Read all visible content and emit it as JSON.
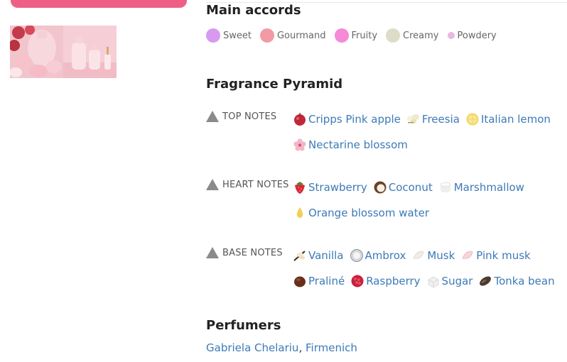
{
  "main_accords": {
    "title": "Main accords",
    "items": [
      {
        "label": "Sweet",
        "color": "#d89af0",
        "size": 20
      },
      {
        "label": "Gourmand",
        "color": "#f29aa6",
        "size": 20
      },
      {
        "label": "Fruity",
        "color": "#f48ad8",
        "size": 20
      },
      {
        "label": "Creamy",
        "color": "#dcdcc8",
        "size": 20
      },
      {
        "label": "Powdery",
        "color": "#e8b8e0",
        "size": 10
      }
    ]
  },
  "pyramid": {
    "title": "Fragrance Pyramid",
    "tiers": [
      {
        "label": "TOP NOTES",
        "rows": [
          [
            {
              "name": "Cripps Pink apple",
              "icon": "apple-icon"
            },
            {
              "name": "Freesia",
              "icon": "freesia-icon"
            },
            {
              "name": "Italian lemon",
              "icon": "lemon-icon"
            }
          ],
          [
            {
              "name": "Nectarine blossom",
              "icon": "blossom-icon"
            }
          ]
        ]
      },
      {
        "label": "HEART NOTES",
        "rows": [
          [
            {
              "name": "Strawberry",
              "icon": "strawberry-icon"
            },
            {
              "name": "Coconut",
              "icon": "coconut-icon"
            },
            {
              "name": "Marshmallow",
              "icon": "marshmallow-icon"
            }
          ],
          [
            {
              "name": "Orange blossom water",
              "icon": "water-drop-icon"
            }
          ]
        ]
      },
      {
        "label": "BASE NOTES",
        "rows": [
          [
            {
              "name": "Vanilla",
              "icon": "vanilla-icon"
            },
            {
              "name": "Ambrox",
              "icon": "ambrox-icon"
            },
            {
              "name": "Musk",
              "icon": "musk-icon"
            },
            {
              "name": "Pink musk",
              "icon": "pink-musk-icon"
            }
          ],
          [
            {
              "name": "Praliné",
              "icon": "praline-icon"
            },
            {
              "name": "Raspberry",
              "icon": "raspberry-icon"
            },
            {
              "name": "Sugar",
              "icon": "sugar-icon"
            },
            {
              "name": "Tonka bean",
              "icon": "tonka-bean-icon"
            }
          ]
        ]
      }
    ]
  },
  "perfumers": {
    "title": "Perfumers",
    "names": [
      "Gabriela Chelariu",
      "Firmenich"
    ],
    "separator": ","
  }
}
